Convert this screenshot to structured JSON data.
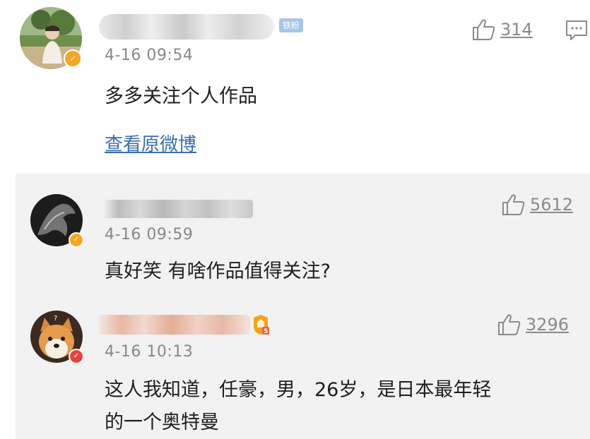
{
  "comment": {
    "badge": "铁粉",
    "time": "4-16 09:54",
    "text": "多多关注个人作品",
    "link": "查看原微博",
    "likes": "314"
  },
  "replies": [
    {
      "time": "4-16 09:59",
      "text": "真好笑 有啥作品值得关注?",
      "likes": "5612"
    },
    {
      "time": "4-16 10:13",
      "text_line1": "这人我知道，任豪，男，26岁，是日本最年轻",
      "text_line2": "的一个奥特曼",
      "likes": "3296"
    }
  ],
  "colors": {
    "link": "#3a6eae",
    "verified_gold": "#f5a623",
    "verified_red": "#e64340",
    "fan_badge": "#a9c5e6",
    "reply_bg": "#f2f2f2"
  },
  "icons": [
    "thumbs-up-icon",
    "comment-icon",
    "verified-badge-icon",
    "fan-level-icon"
  ]
}
